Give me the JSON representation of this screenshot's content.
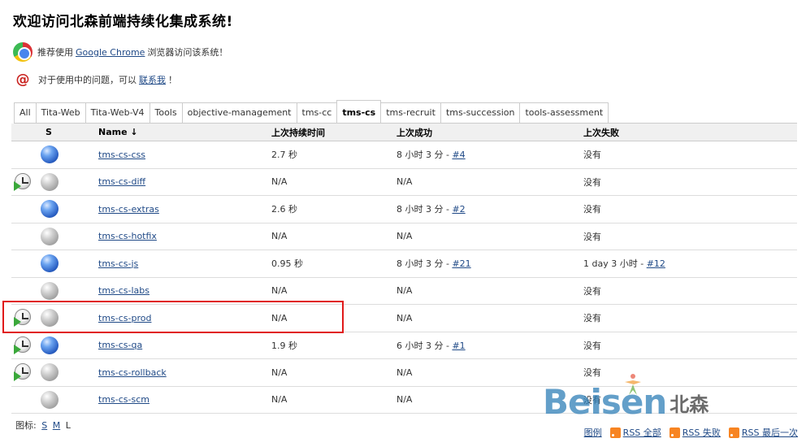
{
  "page": {
    "title": "欢迎访问北森前端持续化集成系统!"
  },
  "recommend": {
    "prefix": "推荐使用",
    "link": "Google Chrome",
    "suffix": "浏览器访问该系统！"
  },
  "contact": {
    "prefix": "对于使用中的问题，可以",
    "link": "联系我",
    "suffix": "！"
  },
  "tabs": [
    {
      "label": "All"
    },
    {
      "label": "Tita-Web"
    },
    {
      "label": "Tita-Web-V4"
    },
    {
      "label": "Tools"
    },
    {
      "label": "objective-management"
    },
    {
      "label": "tms-cc"
    },
    {
      "label": "tms-cs",
      "active": true
    },
    {
      "label": "tms-recruit"
    },
    {
      "label": "tms-succession"
    },
    {
      "label": "tools-assessment"
    }
  ],
  "table": {
    "headers": {
      "s": "S",
      "name": "Name ↓",
      "duration": "上次持续时间",
      "success": "上次成功",
      "failure": "上次失败"
    },
    "rows": [
      {
        "name": "tms-cs-css",
        "scheduled": false,
        "status": "blue",
        "duration": "2.7 秒",
        "success_text": "8 小时 3 分 - ",
        "success_link": "#4",
        "failure_text": "没有",
        "failure_link": ""
      },
      {
        "name": "tms-cs-diff",
        "scheduled": true,
        "status": "grey",
        "duration": "N/A",
        "success_text": "N/A",
        "success_link": "",
        "failure_text": "没有",
        "failure_link": ""
      },
      {
        "name": "tms-cs-extras",
        "scheduled": false,
        "status": "blue",
        "duration": "2.6 秒",
        "success_text": "8 小时 3 分 - ",
        "success_link": "#2",
        "failure_text": "没有",
        "failure_link": ""
      },
      {
        "name": "tms-cs-hotfix",
        "scheduled": false,
        "status": "grey",
        "duration": "N/A",
        "success_text": "N/A",
        "success_link": "",
        "failure_text": "没有",
        "failure_link": ""
      },
      {
        "name": "tms-cs-js",
        "scheduled": false,
        "status": "blue",
        "duration": "0.95 秒",
        "success_text": "8 小时 3 分 - ",
        "success_link": "#21",
        "failure_text": "1 day 3 小时 - ",
        "failure_link": "#12"
      },
      {
        "name": "tms-cs-labs",
        "scheduled": false,
        "status": "grey",
        "duration": "N/A",
        "success_text": "N/A",
        "success_link": "",
        "failure_text": "没有",
        "failure_link": ""
      },
      {
        "name": "tms-cs-prod",
        "scheduled": true,
        "status": "grey",
        "duration": "N/A",
        "success_text": "N/A",
        "success_link": "",
        "failure_text": "没有",
        "failure_link": ""
      },
      {
        "name": "tms-cs-qa",
        "scheduled": true,
        "status": "blue",
        "duration": "1.9 秒",
        "success_text": "6 小时 3 分 - ",
        "success_link": "#1",
        "failure_text": "没有",
        "failure_link": ""
      },
      {
        "name": "tms-cs-rollback",
        "scheduled": true,
        "status": "grey",
        "duration": "N/A",
        "success_text": "N/A",
        "success_link": "",
        "failure_text": "没有",
        "failure_link": ""
      },
      {
        "name": "tms-cs-scm",
        "scheduled": false,
        "status": "grey",
        "duration": "N/A",
        "success_text": "N/A",
        "success_link": "",
        "failure_text": "没有",
        "failure_link": ""
      }
    ]
  },
  "legend": {
    "label": "图标:",
    "sizes": [
      "S",
      "M",
      "L"
    ],
    "current": "L"
  },
  "footer": {
    "legend_link": "图例",
    "rss_all": "RSS 全部",
    "rss_failed": "RSS 失败",
    "rss_latest": "RSS 最后一次"
  },
  "watermark": {
    "brand": "Beisen",
    "brand_cn": "北森"
  },
  "colors": {
    "link": "#204a87",
    "highlight": "#e01919",
    "status_blue": "#2a5fc3",
    "status_grey": "#9a9a9a"
  }
}
